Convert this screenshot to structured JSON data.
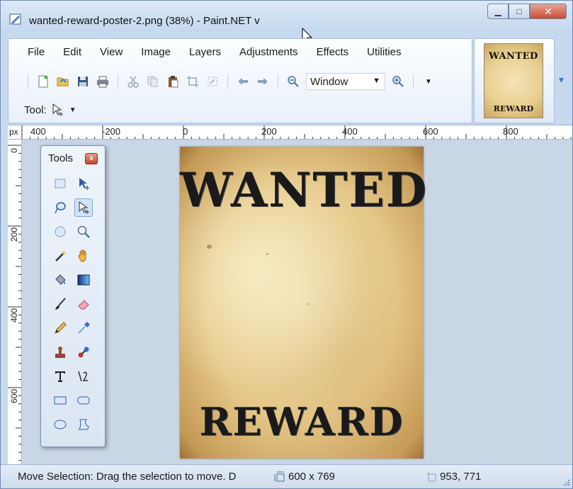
{
  "window": {
    "title": "wanted-reward-poster-2.png (38%) - Paint.NET v",
    "minimize_label": "▁",
    "maximize_label": "□",
    "close_label": "✕"
  },
  "menu": [
    "File",
    "Edit",
    "View",
    "Image",
    "Layers",
    "Adjustments",
    "Effects",
    "Utilities"
  ],
  "toolbar": {
    "zoom_value": "Window",
    "tool_label": "Tool:"
  },
  "thumbnail": {
    "top_text": "WANTED",
    "bottom_text": "REWARD"
  },
  "ruler": {
    "unit": "px",
    "h_labels": [
      "400",
      "-200",
      "0",
      "200",
      "400",
      "600",
      "800"
    ],
    "v_labels": [
      "0",
      "200",
      "400",
      "600"
    ]
  },
  "tools_window": {
    "title": "Tools",
    "close_label": "x",
    "tools": [
      "rectangle-select",
      "move-selected-pixels",
      "lasso-select",
      "move-selection",
      "ellipse-select",
      "zoom",
      "magic-wand",
      "pan",
      "paint-bucket",
      "gradient",
      "paintbrush",
      "eraser",
      "pencil",
      "color-picker",
      "clone-stamp",
      "recolor",
      "text",
      "line-curve",
      "rectangle",
      "rounded-rectangle",
      "ellipse",
      "freeform-shape"
    ]
  },
  "poster": {
    "title": "WANTED",
    "subtitle": "REWARD"
  },
  "status": {
    "message": "Move Selection: Drag the selection to move. D",
    "image_size": "600 x 769",
    "cursor_position": "953, 771"
  }
}
